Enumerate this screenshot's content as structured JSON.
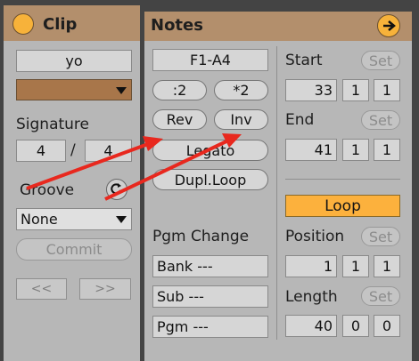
{
  "clip": {
    "header": "Clip",
    "name": "yo",
    "signature_label": "Signature",
    "signature_numerator": "4",
    "signature_slash": "/",
    "signature_denominator": "4",
    "groove_label": "Groove",
    "groove_value": "None",
    "commit_label": "Commit",
    "nav_prev": "<<",
    "nav_next": ">>"
  },
  "notes": {
    "header": "Notes",
    "range": "F1-A4",
    "div2": ":2",
    "mul2": "*2",
    "rev": "Rev",
    "inv": "Inv",
    "legato": "Legato",
    "dupl_loop": "Dupl.Loop",
    "pgm_change_label": "Pgm Change",
    "bank": "Bank ---",
    "sub": "Sub ---",
    "pgm": "Pgm ---",
    "start_label": "Start",
    "start_set": "Set",
    "start_values": [
      "33",
      "1",
      "1"
    ],
    "end_label": "End",
    "end_set": "Set",
    "end_values": [
      "41",
      "1",
      "1"
    ],
    "loop_label": "Loop",
    "position_label": "Position",
    "position_set": "Set",
    "position_values": [
      "1",
      "1",
      "1"
    ],
    "length_label": "Length",
    "length_set": "Set",
    "length_values": [
      "40",
      "0",
      "0"
    ]
  },
  "colors": {
    "header": "#b38f6c",
    "panel": "#b7b7b7",
    "activator": "#f7b23a",
    "loop_on": "#fcb13d",
    "annotation_arrow": "#e8281e"
  },
  "icons": {
    "clip_activator": "activator-circle-icon",
    "notes_expand": "arrow-right-circle-icon",
    "dropdown": "triangle-down-icon",
    "groove_hotswap": "hotswap-icon"
  }
}
